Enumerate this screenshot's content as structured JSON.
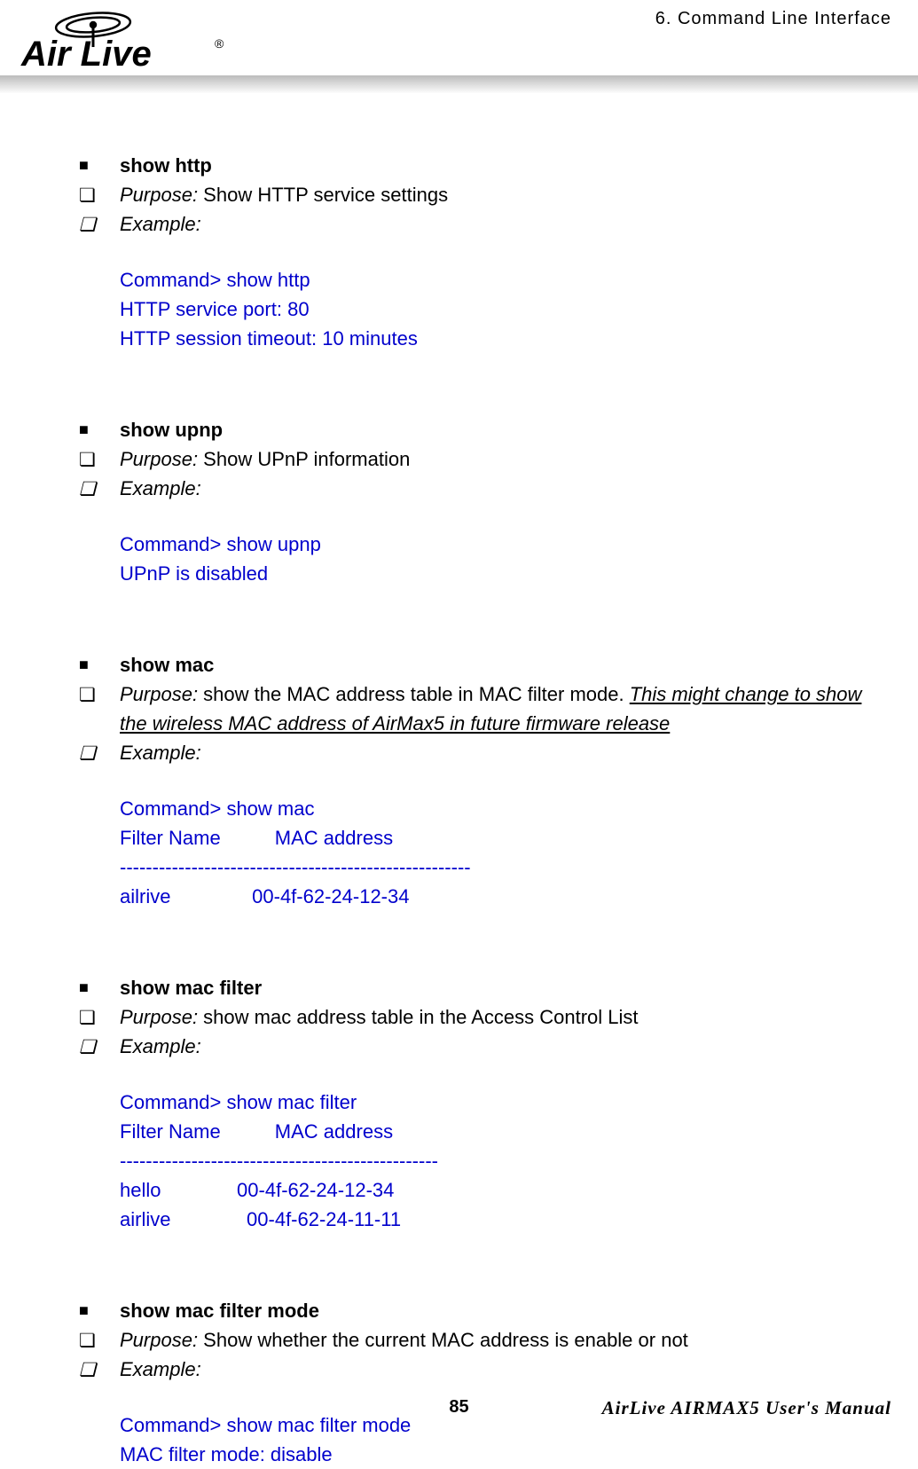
{
  "header": {
    "chapter": "6.  Command Line Interface",
    "logo_alt": "Air Live"
  },
  "sections": [
    {
      "title": "show http",
      "purpose_label": "Purpose:",
      "purpose_text": " Show HTTP service settings",
      "purpose_note": "",
      "example_label": "Example:",
      "code": "Command> show http\nHTTP service port: 80\nHTTP session timeout: 10 minutes"
    },
    {
      "title": "show upnp",
      "purpose_label": "Purpose:",
      "purpose_text": " Show UPnP information",
      "purpose_note": "",
      "example_label": "Example:",
      "code": "Command> show upnp\nUPnP is disabled"
    },
    {
      "title": "show mac",
      "purpose_label": "Purpose:",
      "purpose_text": " show the MAC address table in MAC filter mode.   ",
      "purpose_note": "This might change to show the wireless MAC address of AirMax5 in future firmware release",
      "example_label": "Example:",
      "code": "Command> show mac\nFilter Name          MAC address\n------------------------------------------------------\nailrive               00-4f-62-24-12-34"
    },
    {
      "title": "show mac filter",
      "purpose_label": "Purpose:  ",
      "purpose_text": " show mac address table in the Access Control List",
      "purpose_note": "",
      "example_label": "Example:",
      "code": "Command> show mac filter\nFilter Name          MAC address\n-------------------------------------------------\nhello              00-4f-62-24-12-34\nairlive              00-4f-62-24-11-11"
    },
    {
      "title": "show mac filter mode",
      "purpose_label": "Purpose:",
      "purpose_text": " Show whether the current MAC address is enable or not",
      "purpose_note": "",
      "example_label": "Example:",
      "code": "Command> show mac filter mode\nMAC filter mode: disable"
    }
  ],
  "footer": {
    "page": "85",
    "manual": "AirLive AIRMAX5 User's Manual"
  }
}
